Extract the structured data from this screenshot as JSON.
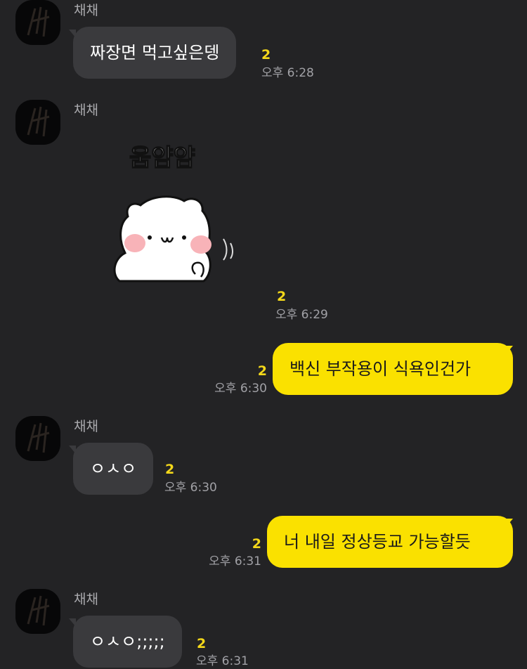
{
  "messages": [
    {
      "sender": "채채",
      "text": "짜장면 먹고싶은뎅",
      "unread": "2",
      "time": "오후 6:28"
    },
    {
      "sender": "채채",
      "emoticon": {
        "name": "white-bear-eating-emoticon",
        "caption": "움얌얌"
      },
      "unread": "2",
      "time": "오후 6:29"
    },
    {
      "text": "백신 부작용이 식욕인건가",
      "unread": "2",
      "time": "오후 6:30"
    },
    {
      "sender": "채채",
      "text": "ㅇㅅㅇ",
      "unread": "2",
      "time": "오후 6:30"
    },
    {
      "text": "너 내일 정상등교 가능할듯",
      "unread": "2",
      "time": "오후 6:31"
    },
    {
      "sender": "채채",
      "text": "ㅇㅅㅇ;;;;;",
      "unread": "2",
      "time": "오후 6:31"
    }
  ],
  "colors": {
    "background": "#232325",
    "incoming_bubble": "#3a3a3d",
    "outgoing_bubble": "#fae100",
    "unread_count": "#f4d81a"
  }
}
